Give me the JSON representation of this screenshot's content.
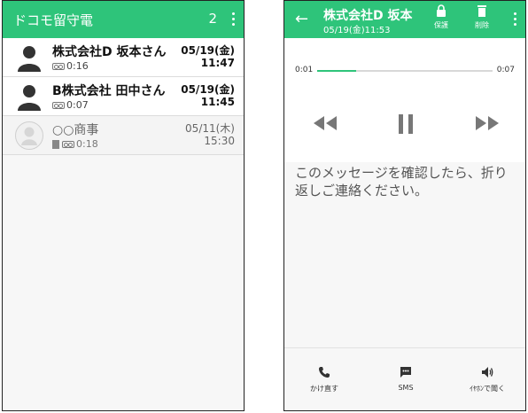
{
  "left_screen": {
    "app_title": "ドコモ留守電",
    "unread_count": "2",
    "messages": [
      {
        "name": "株式会社D 坂本さん",
        "duration": "0:16",
        "date": "05/19(金)",
        "time": "11:47",
        "unread": true
      },
      {
        "name": "B株式会社 田中さん",
        "duration": "0:07",
        "date": "05/19(金)",
        "time": "11:45",
        "unread": true
      },
      {
        "name": "○○商事",
        "duration": "0:18",
        "date": "05/11(木)",
        "time": "15:30",
        "unread": false
      }
    ]
  },
  "right_screen": {
    "title": "株式会社D 坂本",
    "subtitle": "05/19(金)11:53",
    "actions": {
      "protect_label": "保護",
      "delete_label": "削除"
    },
    "player": {
      "elapsed": "0:01",
      "total": "0:07",
      "progress": 0.22
    },
    "transcript": "このメッセージを確認したら、折り返しご連絡ください。",
    "bottom": {
      "call_label": "かけ直す",
      "sms_label": "SMS",
      "speaker_label": "ｲﾔﾎﾝで聞く"
    }
  },
  "colors": {
    "accent": "#2ec47a",
    "accent_dark": "#25a864"
  }
}
